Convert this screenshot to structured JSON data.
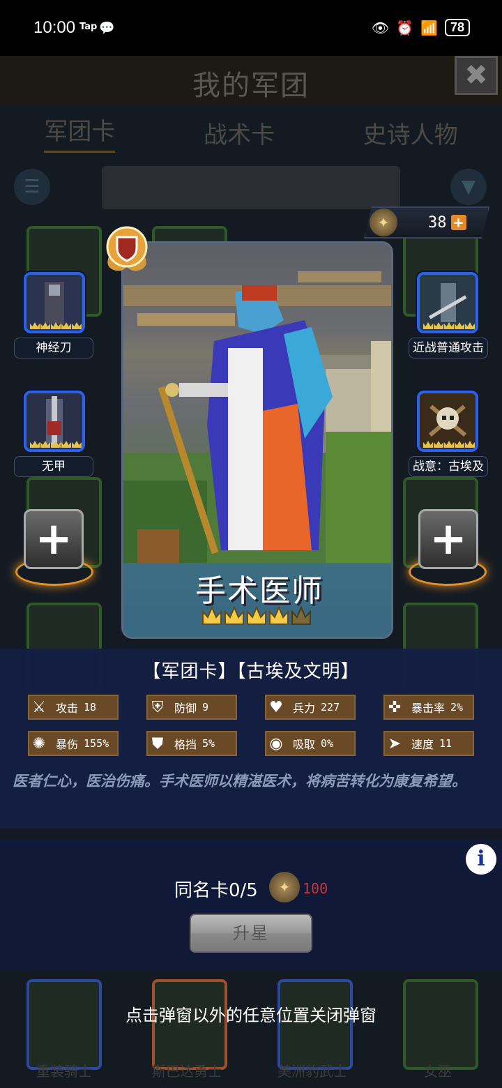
{
  "status_bar": {
    "time": "10:00",
    "notif_app": "Tap",
    "battery": "78"
  },
  "background_page": {
    "title": "我的军团",
    "tabs": [
      "军团卡",
      "战术卡",
      "史诗人物"
    ],
    "cards_row1": [
      "重装骑士",
      "斯巴达勇士",
      "美洲豹武士",
      "女巫"
    ]
  },
  "currency": {
    "amount": "38"
  },
  "card": {
    "name": "手术医师",
    "stars_filled": 4,
    "stars_total": 5
  },
  "skills": {
    "left_top": "神经刀",
    "left_mid": "无甲",
    "right_top": "近战普通攻击",
    "right_mid": "战意：古埃及"
  },
  "info": {
    "tags": "【军团卡】【古埃及文明】",
    "stats": [
      {
        "label": "攻击",
        "value": "18",
        "icon": "sword-icon"
      },
      {
        "label": "防御",
        "value": "9",
        "icon": "shield-icon"
      },
      {
        "label": "兵力",
        "value": "227",
        "icon": "heart-icon"
      },
      {
        "label": "暴击率",
        "value": "2%",
        "icon": "crosshair-icon"
      },
      {
        "label": "暴伤",
        "value": "155%",
        "icon": "burst-icon"
      },
      {
        "label": "格挡",
        "value": "5%",
        "icon": "block-icon"
      },
      {
        "label": "吸取",
        "value": "0%",
        "icon": "drain-icon"
      },
      {
        "label": "速度",
        "value": "11",
        "icon": "boot-icon"
      }
    ],
    "description": "医者仁心，医治伤痛。手术医师以精湛医术，将病苦转化为康复希望。"
  },
  "upgrade": {
    "same_name_label": "同名卡0/5",
    "cost": "100",
    "button_label": "升星"
  },
  "close_hint": "点击弹窗以外的任意位置关闭弹窗",
  "colors": {
    "panel": "#141e42",
    "stat_bg": "#6a4a26",
    "skill_border": "#2b62e8",
    "accent_orange": "#e58a2a",
    "cost_red": "#c23a3a"
  }
}
